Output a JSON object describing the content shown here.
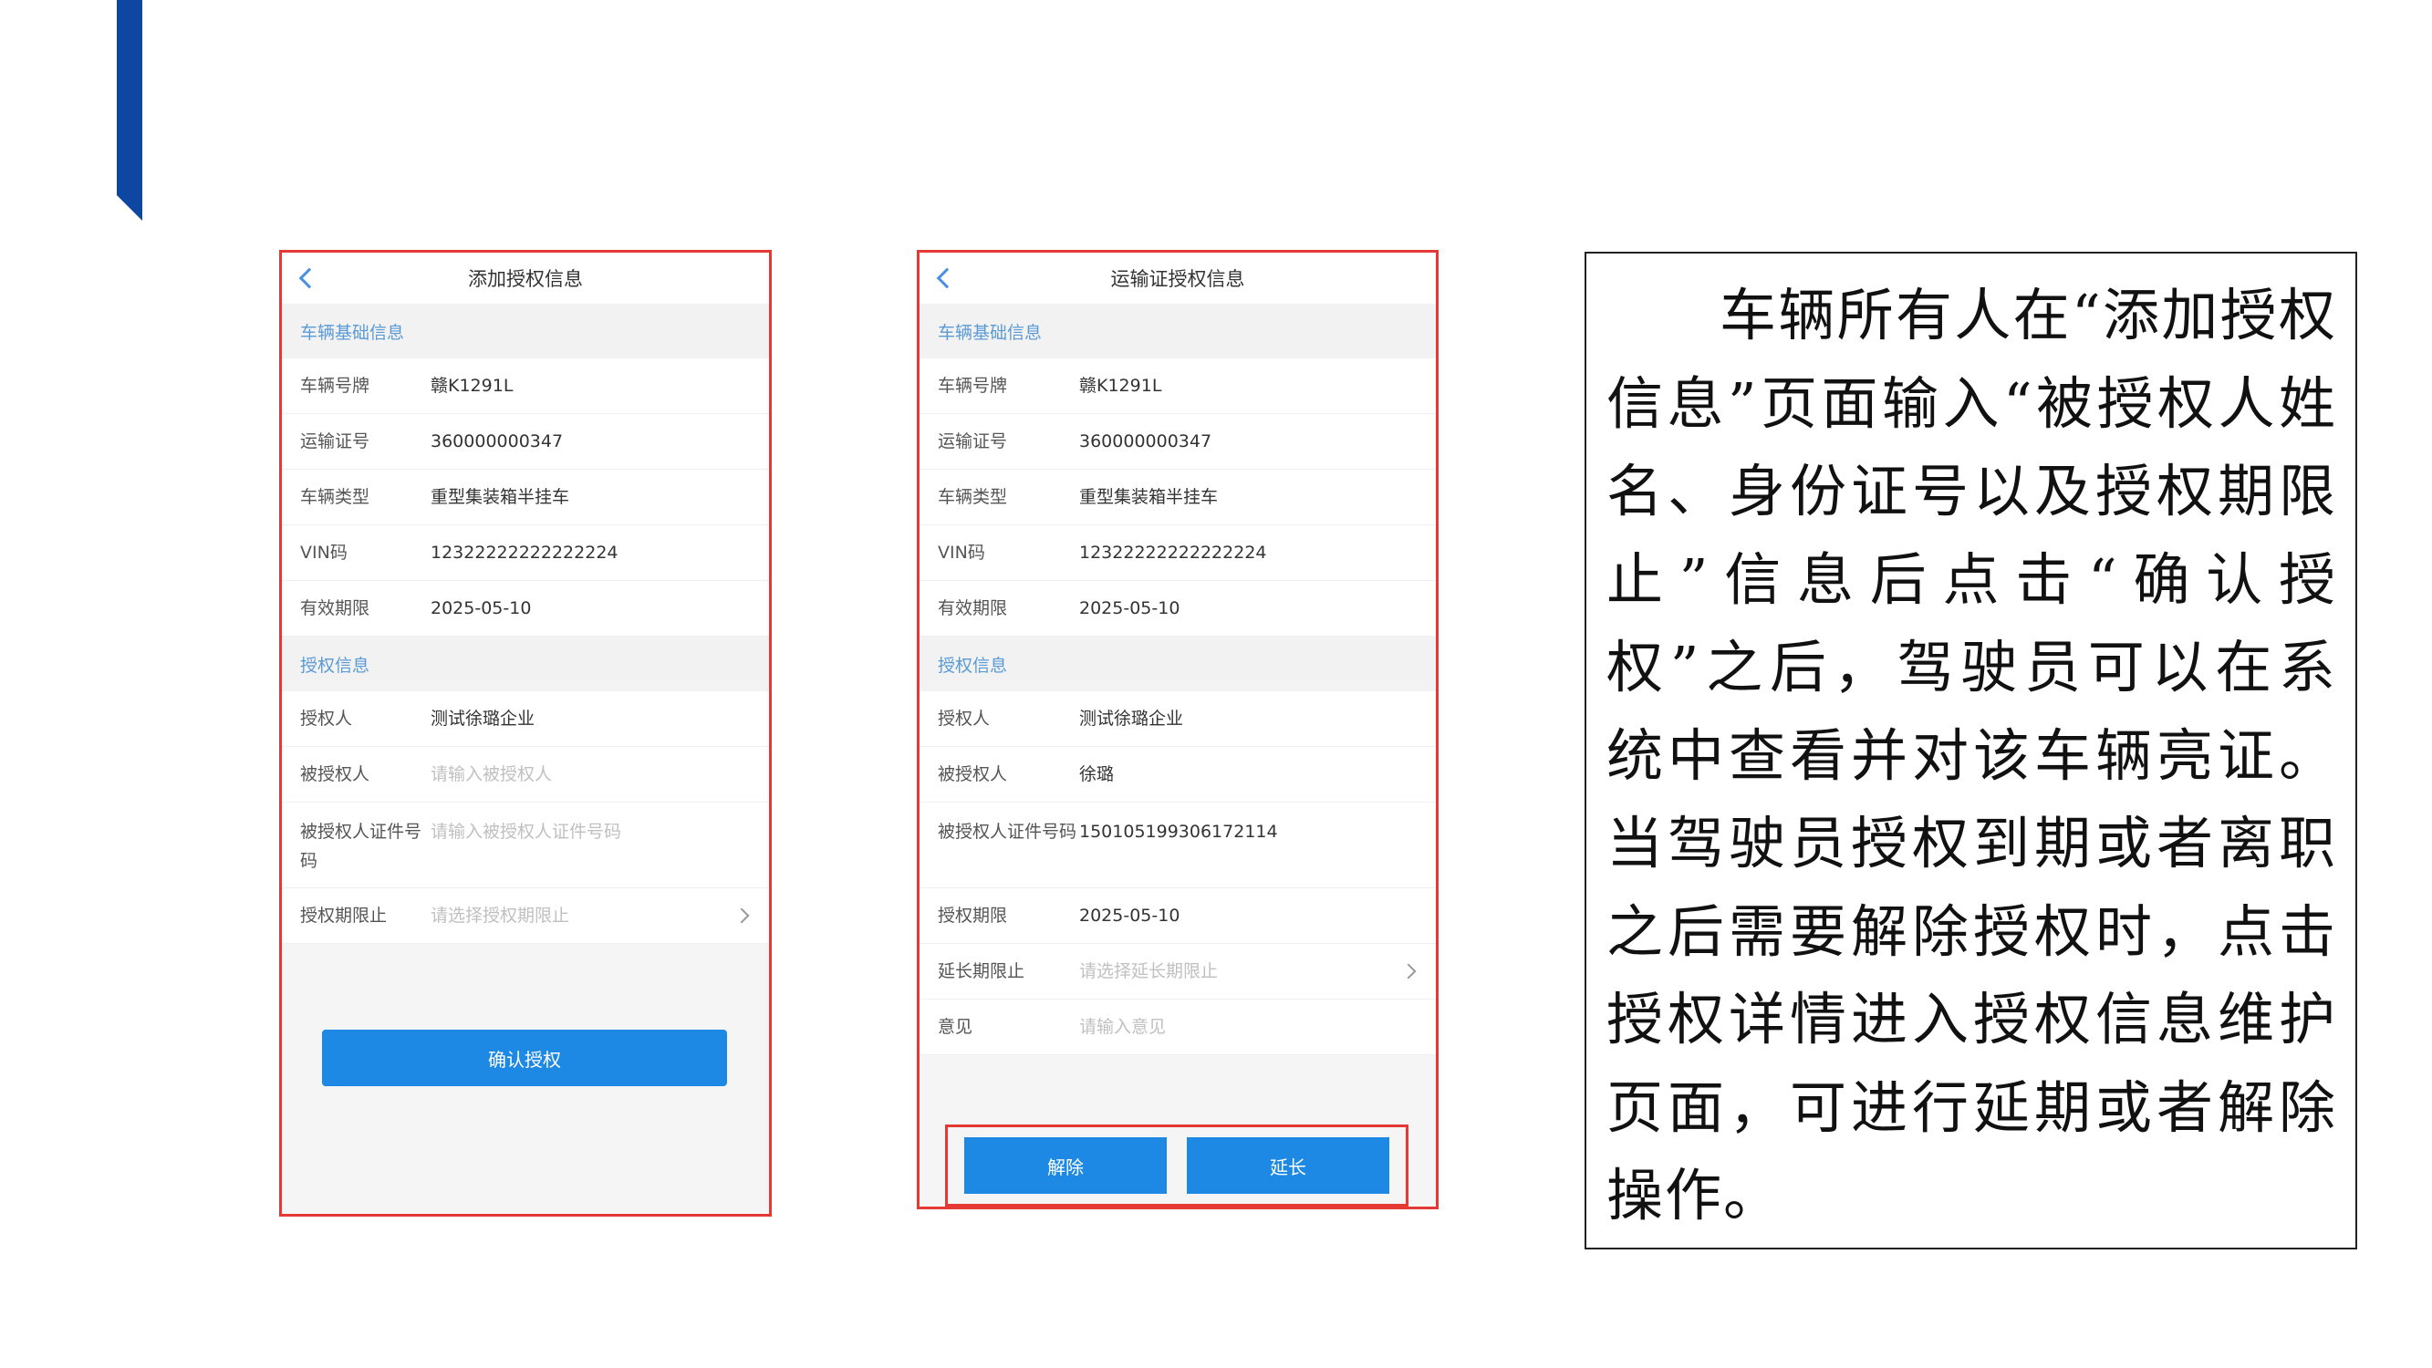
{
  "add_screen": {
    "title": "添加授权信息",
    "vehicle_section": "车辆基础信息",
    "vehicle_rows": [
      {
        "label": "车辆号牌",
        "value": "赣K1291L"
      },
      {
        "label": "运输证号",
        "value": "360000000347"
      },
      {
        "label": "车辆类型",
        "value": "重型集装箱半挂车"
      },
      {
        "label": "VIN码",
        "value": "12322222222222224"
      },
      {
        "label": "有效期限",
        "value": "2025-05-10"
      }
    ],
    "auth_section": "授权信息",
    "auth_rows": [
      {
        "label": "授权人",
        "value": "测试徐璐企业"
      },
      {
        "label": "被授权人",
        "placeholder": "请输入被授权人"
      },
      {
        "label": "被授权人证件号码",
        "placeholder": "请输入被授权人证件号码"
      },
      {
        "label": "授权期限止",
        "placeholder": "请选择授权期限止"
      }
    ],
    "confirm_button": "确认授权"
  },
  "detail_screen": {
    "title": "运输证授权信息",
    "vehicle_section": "车辆基础信息",
    "vehicle_rows": [
      {
        "label": "车辆号牌",
        "value": "赣K1291L"
      },
      {
        "label": "运输证号",
        "value": "360000000347"
      },
      {
        "label": "车辆类型",
        "value": "重型集装箱半挂车"
      },
      {
        "label": "VIN码",
        "value": "12322222222222224"
      },
      {
        "label": "有效期限",
        "value": "2025-05-10"
      }
    ],
    "auth_section": "授权信息",
    "auth_rows": [
      {
        "label": "授权人",
        "value": "测试徐璐企业"
      },
      {
        "label": "被授权人",
        "value": "徐璐"
      },
      {
        "label": "被授权人证件号码",
        "value": "150105199306172114"
      },
      {
        "label": "授权期限",
        "value": "2025-05-10"
      },
      {
        "label": "延长期限止",
        "placeholder": "请选择延长期限止"
      },
      {
        "label": "意见",
        "placeholder": "请输入意见"
      }
    ],
    "remove_button": "解除",
    "extend_button": "延长"
  },
  "description": "车辆所有人在“添加授权信息”页面输入“被授权人姓名、身份证号以及授权期限止”信息后点击“确认授权”之后，驾驶员可以在系统中查看并对该车辆亮证。当驾驶员授权到期或者离职之后需要解除授权时，点击授权详情进入授权信息维护页面，可进行延期或者解除操作。",
  "colors": {
    "accent_bar": "#0d47a1",
    "highlight_border": "#e53935",
    "primary_button": "#1e88e5",
    "section_text": "#5b9bd5"
  }
}
